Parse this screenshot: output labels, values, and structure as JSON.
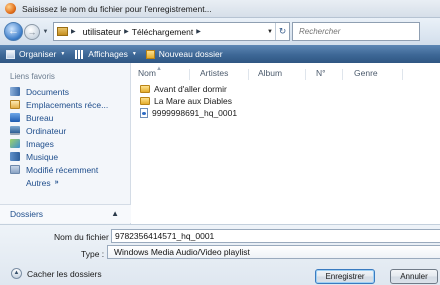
{
  "window": {
    "title": "Saisissez le nom du fichier pour l'enregistrement..."
  },
  "nav": {
    "breadcrumbs": [
      "utilisateur",
      "Téléchargement"
    ],
    "search_placeholder": "Rechercher"
  },
  "toolbar": {
    "organize": "Organiser",
    "views": "Affichages",
    "new_folder": "Nouveau dossier"
  },
  "sidebar": {
    "favorites_title": "Liens favoris",
    "items": [
      {
        "label": "Documents",
        "icon": "documents-icon"
      },
      {
        "label": "Emplacements réce...",
        "icon": "recent-places-icon"
      },
      {
        "label": "Bureau",
        "icon": "desktop-icon"
      },
      {
        "label": "Ordinateur",
        "icon": "computer-icon"
      },
      {
        "label": "Images",
        "icon": "pictures-icon"
      },
      {
        "label": "Musique",
        "icon": "music-icon"
      },
      {
        "label": "Modifié récemment",
        "icon": "recently-changed-icon"
      }
    ],
    "more": "Autres",
    "folders": "Dossiers"
  },
  "files": {
    "columns": [
      "Nom",
      "Artistes",
      "Album",
      "N°",
      "Genre"
    ],
    "items": [
      {
        "name": "Avant d'aller dormir",
        "type": "folder"
      },
      {
        "name": "La Mare aux Diables",
        "type": "folder"
      },
      {
        "name": "9999998691_hq_0001",
        "type": "playlist"
      }
    ]
  },
  "form": {
    "filename_label": "Nom du fichier :",
    "filename_value": "9782356414571_hq_0001",
    "type_label": "Type :",
    "type_value": "Windows Media Audio/Video playlist",
    "hide_folders": "Cacher les dossiers",
    "save": "Enregistrer",
    "cancel": "Annuler"
  }
}
